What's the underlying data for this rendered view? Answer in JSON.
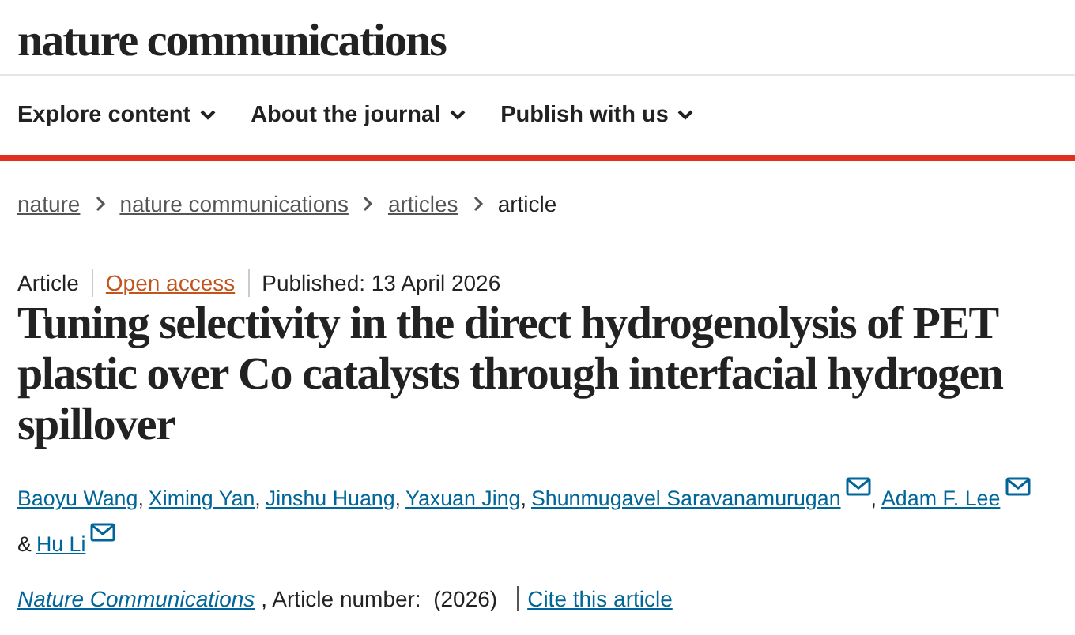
{
  "site": {
    "logo": "nature communications"
  },
  "nav": [
    {
      "label": "Explore content"
    },
    {
      "label": "About the journal"
    },
    {
      "label": "Publish with us"
    }
  ],
  "breadcrumbs": [
    {
      "label": "nature",
      "link": true
    },
    {
      "label": "nature communications",
      "link": true
    },
    {
      "label": "articles",
      "link": true
    },
    {
      "label": "article",
      "link": false
    }
  ],
  "meta": [
    {
      "kind": "text",
      "text": "Article"
    },
    {
      "kind": "link",
      "text": "Open access"
    },
    {
      "kind": "text",
      "text": "Published: 13 April 2026"
    }
  ],
  "title": "Tuning selectivity in the direct hydrogenolysis of PET plastic over Co catalysts through interfacial hydrogen spillover",
  "authors": [
    {
      "kind": "author",
      "name": "Baoyu Wang",
      "email": false
    },
    {
      "kind": "text",
      "text": ","
    },
    {
      "kind": "author",
      "name": "Ximing Yan",
      "email": false
    },
    {
      "kind": "text",
      "text": ","
    },
    {
      "kind": "author",
      "name": "Jinshu Huang",
      "email": false
    },
    {
      "kind": "text",
      "text": ","
    },
    {
      "kind": "author",
      "name": "Yaxuan Jing",
      "email": false
    },
    {
      "kind": "text",
      "text": ","
    },
    {
      "kind": "author",
      "name": "Shunmugavel Saravanamurugan",
      "email": true
    },
    {
      "kind": "text",
      "text": ","
    },
    {
      "kind": "author",
      "name": "Adam F. Lee",
      "email": true
    },
    {
      "kind": "break"
    },
    {
      "kind": "text",
      "text": "&"
    },
    {
      "kind": "author",
      "name": "Hu Li",
      "email": true
    }
  ],
  "citation": {
    "journal": "Nature Communications",
    "details": ", Article number:  (2026)",
    "cite_link": "Cite this article"
  }
}
